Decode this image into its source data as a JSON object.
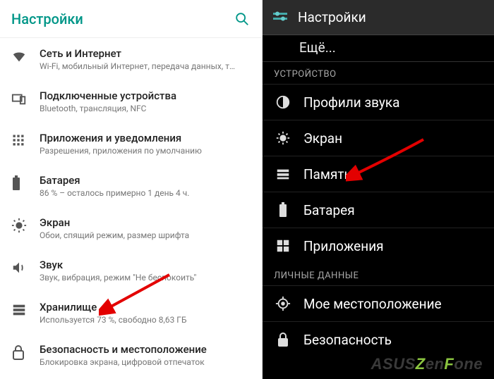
{
  "left": {
    "title": "Настройки",
    "items": [
      {
        "icon": "wifi-icon",
        "label": "Сеть и Интернет",
        "sub": "Wi-Fi, мобильный Интернет, передача данных, т…"
      },
      {
        "icon": "linked-devices-icon",
        "label": "Подключенные устройства",
        "sub": "Bluetooth, трансляция, NFC"
      },
      {
        "icon": "apps-icon",
        "label": "Приложения и уведомления",
        "sub": "Разрешения, приложения по умолчанию"
      },
      {
        "icon": "battery-icon",
        "label": "Батарея",
        "sub": "86 % – осталось примерно 1 день 4 ч."
      },
      {
        "icon": "display-icon",
        "label": "Экран",
        "sub": "Обои, спящий режим, размер шрифта"
      },
      {
        "icon": "sound-icon",
        "label": "Звук",
        "sub": "Звук, вибрация, режим \"Не беспокоить\""
      },
      {
        "icon": "storage-icon",
        "label": "Хранилище",
        "sub": "Используется 73 %, свободно 8,63 ГБ"
      },
      {
        "icon": "security-icon",
        "label": "Безопасность и местоположение",
        "sub": "Блокировка экрана, цифровой отпечаток"
      }
    ]
  },
  "right": {
    "title": "Настройки",
    "more": "Ещё...",
    "section_device": "УСТРОЙСТВО",
    "section_personal": "ЛИЧНЫЕ ДАННЫЕ",
    "device_items": [
      {
        "icon": "sound-profile-icon",
        "label": "Профили звука"
      },
      {
        "icon": "brightness-icon",
        "label": "Экран"
      },
      {
        "icon": "memory-icon",
        "label": "Память"
      },
      {
        "icon": "battery-dark-icon",
        "label": "Батарея"
      },
      {
        "icon": "apps-dark-icon",
        "label": "Приложения"
      }
    ],
    "personal_items": [
      {
        "icon": "location-icon",
        "label": "Мое местоположение"
      },
      {
        "icon": "lock-icon",
        "label": "Безопасность"
      }
    ]
  },
  "watermark": {
    "p1": "ASUS",
    "p2": "Z",
    "p3": "en",
    "p4": "F",
    "p5": "one"
  }
}
